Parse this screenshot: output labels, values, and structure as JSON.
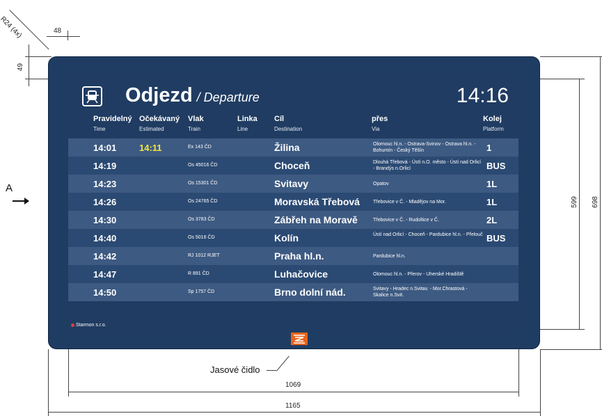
{
  "drawing": {
    "radius_label": "R24 (4x)",
    "dim_top_offset": "48",
    "dim_left_offset": "49",
    "dim_screen_height": "599",
    "dim_total_height": "698",
    "dim_screen_width": "1069",
    "dim_total_width": "1165",
    "section_label": "A",
    "sensor_label": "Jasové čidlo"
  },
  "board": {
    "title": "Odjezd",
    "subtitle": "/ Departure",
    "clock": "14:16",
    "footer": "Starmon s.r.o.",
    "columns": {
      "time": {
        "main": "Pravidelný",
        "sub": "Time"
      },
      "estimated": {
        "main": "Očekávaný",
        "sub": "Estimated"
      },
      "train": {
        "main": "Vlak",
        "sub": "Train"
      },
      "line": {
        "main": "Linka",
        "sub": "Line"
      },
      "destination": {
        "main": "Cíl",
        "sub": "Destination"
      },
      "via": {
        "main": "přes",
        "sub": "Via"
      },
      "platform": {
        "main": "Kolej",
        "sub": "Platform"
      }
    },
    "rows": [
      {
        "time": "14:01",
        "estimated": "14:11",
        "train": "Ex 143 ČD",
        "destination": "Žilina",
        "via": "Olomouc hl.n. - Ostrava-Svinov - Ostrava hl.n. - Bohumín - Český Těšín",
        "platform": "1"
      },
      {
        "time": "14:19",
        "estimated": "",
        "train": "Os 45016 ČD",
        "destination": "Choceň",
        "via": "Dlouhá Třebová - Ústí n.O. město - Ústí nad Orlicí - Brandýs n.Orlicí",
        "platform": "BUS"
      },
      {
        "time": "14:23",
        "estimated": "",
        "train": "Os 15301 ČD",
        "destination": "Svitavy",
        "via": "Opatov",
        "platform": "1L"
      },
      {
        "time": "14:26",
        "estimated": "",
        "train": "Os 24765 ČD",
        "destination": "Moravská Třebová",
        "via": "Třebovice v Č. - Mladějov na Mor.",
        "platform": "1L"
      },
      {
        "time": "14:30",
        "estimated": "",
        "train": "Os 3783 ČD",
        "destination": "Zábřeh na Moravě",
        "via": "Třebovice v Č. - Rudoltice v Č.",
        "platform": "2L"
      },
      {
        "time": "14:40",
        "estimated": "",
        "train": "Os 5016 ČD",
        "destination": "Kolín",
        "via": "Ústí nad Orlicí - Choceň - Pardubice hl.n. - Přelouč",
        "platform": "BUS"
      },
      {
        "time": "14:42",
        "estimated": "",
        "train": "RJ 1012 RJET",
        "destination": "Praha hl.n.",
        "via": "Pardubice hl.n.",
        "platform": ""
      },
      {
        "time": "14:47",
        "estimated": "",
        "train": "R 891 ČD",
        "destination": "Luhačovice",
        "via": "Olomouc hl.n. - Přerov - Uherské Hradiště",
        "platform": ""
      },
      {
        "time": "14:50",
        "estimated": "",
        "train": "Sp 1757 ČD",
        "destination": "Brno dolní nád.",
        "via": "Svitavy - Hradec n.Svitav. - Mor.Chrastová - Skalice n.Svit.",
        "platform": ""
      }
    ]
  }
}
